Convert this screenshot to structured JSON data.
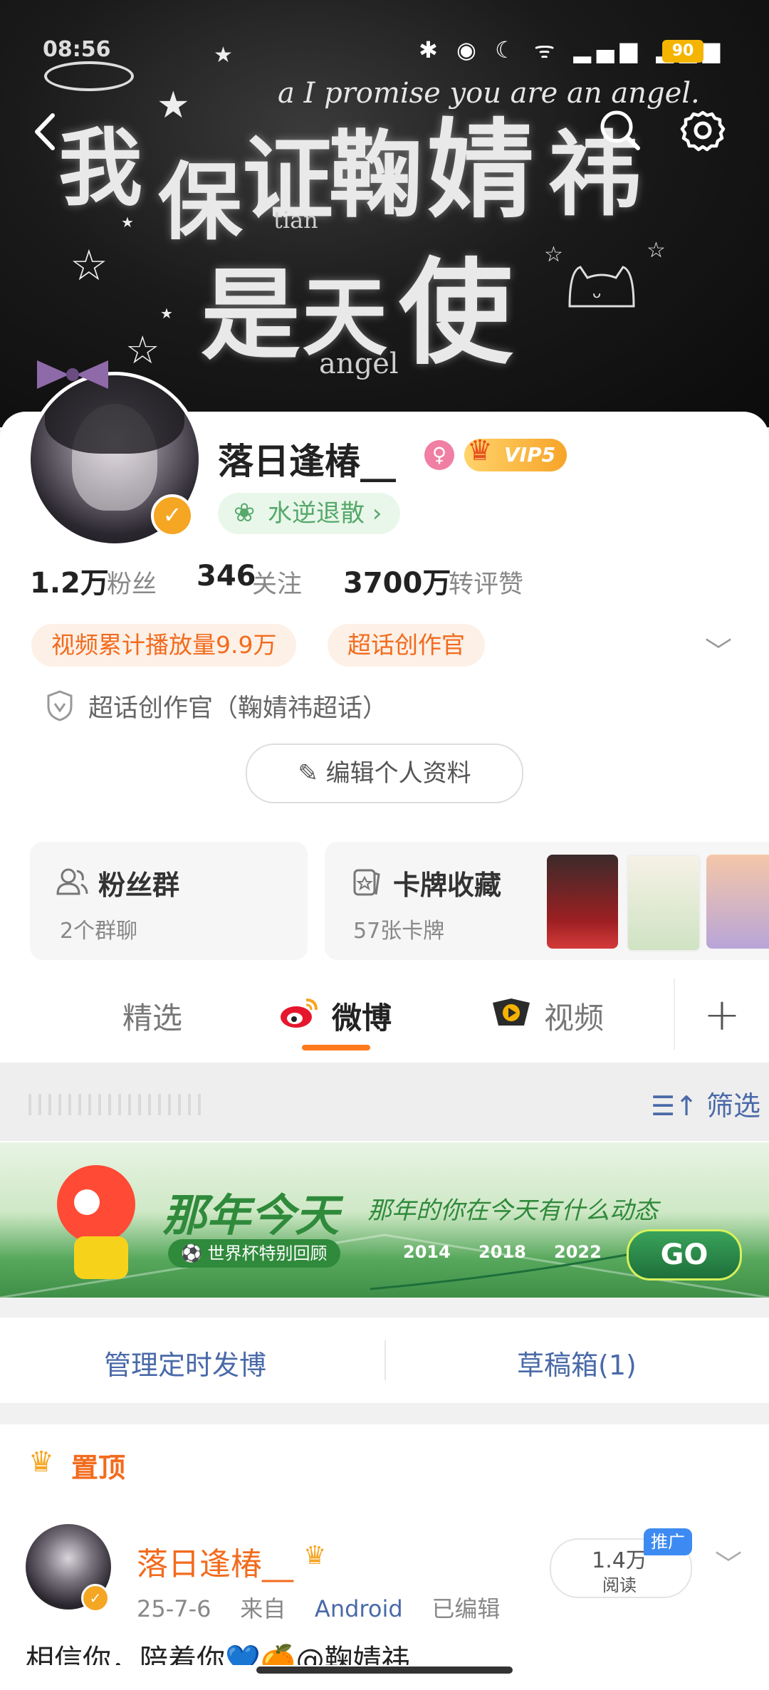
{
  "status_bar": {
    "time": "08:56",
    "battery": "90"
  },
  "banner": {
    "chars_line1": [
      "我",
      "保",
      "证",
      "鞠",
      "婧",
      "祎"
    ],
    "chars_line2": [
      "是",
      "天",
      "使"
    ],
    "tagline": "a I promise you are an angel.",
    "small_en_1": "tian",
    "small_en_2": "angel"
  },
  "profile": {
    "username": "落日逢椿__",
    "vip_label": "VIP5",
    "fan_club": "水逆退散",
    "stats": [
      {
        "num": "1.2万",
        "label": "粉丝"
      },
      {
        "num": "346",
        "label": "关注"
      },
      {
        "num": "3700万",
        "label": "转评赞"
      }
    ],
    "tags": [
      "视频累计播放量9.9万",
      "超话创作官"
    ],
    "creator_line": "超话创作官（鞠婧祎超话）",
    "edit_label": "编辑个人资料"
  },
  "cards": {
    "fans_group": {
      "title": "粉丝群",
      "sub": "2个群聊"
    },
    "card_collection": {
      "title": "卡牌收藏",
      "sub": "57张卡牌"
    }
  },
  "tabs": [
    "精选",
    "微博",
    "视频"
  ],
  "filter": {
    "label": "筛选"
  },
  "promo": {
    "title": "那年今天",
    "subtitle": "那年的你在今天有什么动态",
    "pill": "世界杯特别回顾",
    "years": [
      "2014",
      "2018",
      "2022"
    ],
    "go": "GO"
  },
  "schedule": {
    "manage": "管理定时发博",
    "drafts": "草稿箱(1)"
  },
  "post": {
    "pin_label": "置顶",
    "author": "落日逢椿__",
    "date": "25-7-6",
    "from": "来自",
    "source": "Android",
    "edited": "已编辑",
    "read_num": "1.4万",
    "read_label": "阅读",
    "promo_tag": "推广",
    "text": "相信你，陪着你💙🍊@鞠婧祎"
  },
  "colors": {
    "accent": "#ff7a1a",
    "link": "#4a6aa8",
    "tag_text": "#f26b1d",
    "green": "#56a86b"
  }
}
